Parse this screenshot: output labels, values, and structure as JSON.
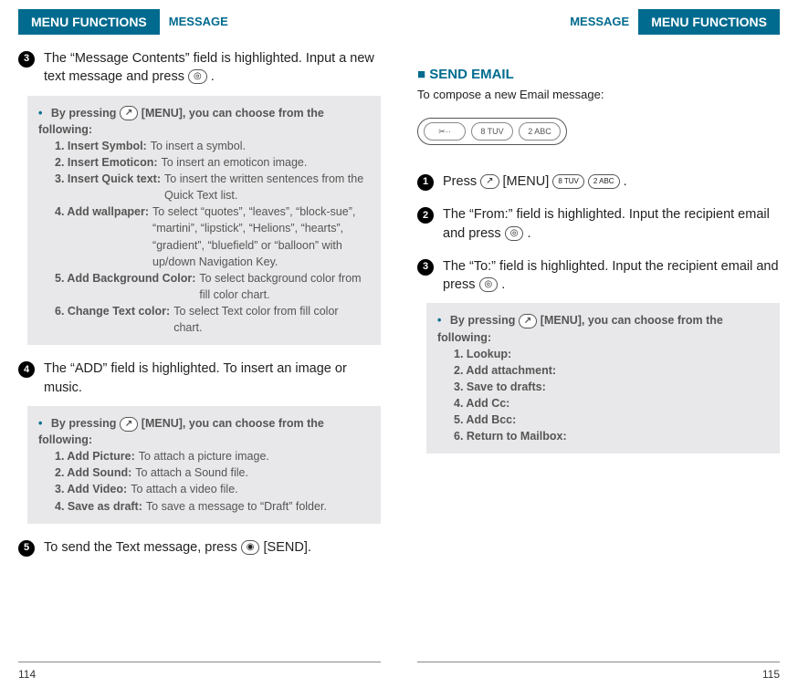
{
  "left": {
    "tab_main": "MENU FUNCTIONS",
    "tab_sub": "MESSAGE",
    "step3": "The “Message Contents” field is highlighted. Input a new text message and press",
    "step3_icon": "◎",
    "step3_end": " .",
    "box1_lead": "By pressing",
    "box1_lead_icon": "↗",
    "box1_lead2": "[MENU], you can choose from the following:",
    "box1_items": [
      {
        "lbl": "1. Insert Symbol:",
        "desc": "To insert a symbol."
      },
      {
        "lbl": "2. Insert Emoticon:",
        "desc": "To insert an emoticon image."
      },
      {
        "lbl": "3. Insert Quick text:",
        "desc": "To insert the written sentences from the Quick Text list."
      },
      {
        "lbl": "4. Add wallpaper:",
        "desc": "To select “quotes”, “leaves”, “block-sue”, “martini”, “lipstick”, “Helions”, “hearts”, “gradient”, “bluefield” or “balloon” with up/down Navigation Key."
      },
      {
        "lbl": "5. Add Background Color:",
        "desc": "To select background color from fill color chart."
      },
      {
        "lbl": "6. Change Text color:",
        "desc": "To select Text color from fill color chart."
      }
    ],
    "step4": "The “ADD” field is highlighted. To insert an image or music.",
    "box2_lead": "By pressing",
    "box2_lead_icon": "↗",
    "box2_lead2": "[MENU], you can choose from the following:",
    "box2_items": [
      {
        "lbl": "1. Add Picture:",
        "desc": "To attach a picture image."
      },
      {
        "lbl": "2. Add Sound:",
        "desc": "To attach a Sound file."
      },
      {
        "lbl": "3. Add Video:",
        "desc": "To attach a video file."
      },
      {
        "lbl": "4. Save as draft:",
        "desc": "To save a message to “Draft” folder."
      }
    ],
    "step5_a": "To send the Text message, press ",
    "step5_icon": "◉",
    "step5_b": " [SEND].",
    "page_num": "114"
  },
  "right": {
    "tab_sub": "MESSAGE",
    "tab_main": "MENU FUNCTIONS",
    "section_mark": "■",
    "section_title": "SEND EMAIL",
    "section_sub": "To compose a new Email message:",
    "key1": "✂··",
    "key2": "8 TUV",
    "key3": "2 ABC",
    "step1_a": "Press",
    "step1_icon1": "↗",
    "step1_b": "[MENU]",
    "step1_key2": "8 TUV",
    "step1_key3": "2 ABC",
    "step1_c": " .",
    "step2": "The “From:” field is highlighted. Input the recipient email and press ",
    "step2_icon": "◎",
    "step2_end": " .",
    "step3": "The “To:” field is highlighted. Input the recipient email and press ",
    "step3_icon": "◎",
    "step3_end": " .",
    "box_lead": "By pressing",
    "box_lead_icon": "↗",
    "box_lead2": "[MENU], you can choose from the following:",
    "box_items": [
      {
        "lbl": "1. Lookup:"
      },
      {
        "lbl": "2. Add attachment:"
      },
      {
        "lbl": "3. Save to drafts:"
      },
      {
        "lbl": "4. Add Cc:"
      },
      {
        "lbl": "5. Add Bcc:"
      },
      {
        "lbl": "6. Return to Mailbox:"
      }
    ],
    "page_num": "115"
  }
}
